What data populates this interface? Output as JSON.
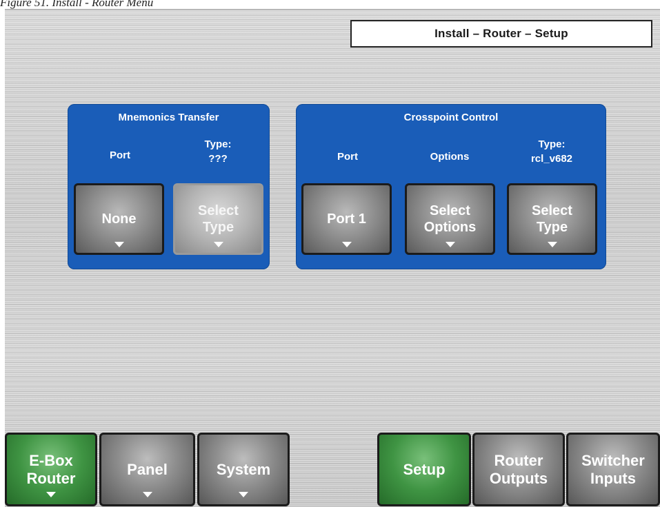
{
  "caption": "Figure 51. Install - Router Menu",
  "header": {
    "title": "Install – Router – Setup"
  },
  "mnemonics": {
    "title": "Mnemonics Transfer",
    "port_label": "Port",
    "type_label": "Type:",
    "type_value": "???",
    "port_button": "None",
    "type_button_line1": "Select",
    "type_button_line2": "Type"
  },
  "crosspoint": {
    "title": "Crosspoint Control",
    "port_label": "Port",
    "options_label": "Options",
    "type_label": "Type:",
    "type_value": "rcl_v682",
    "port_button": "Port 1",
    "options_button_line1": "Select",
    "options_button_line2": "Options",
    "type_button_line1": "Select",
    "type_button_line2": "Type"
  },
  "nav": {
    "ebox_line1": "E-Box",
    "ebox_line2": "Router",
    "panel": "Panel",
    "system": "System",
    "setup": "Setup",
    "router_outputs_line1": "Router",
    "router_outputs_line2": "Outputs",
    "switcher_inputs_line1": "Switcher",
    "switcher_inputs_line2": "Inputs"
  },
  "colors": {
    "group_blue": "#1a5db8",
    "active_green": "#3f9443",
    "button_gray": "#8d8d8d"
  }
}
